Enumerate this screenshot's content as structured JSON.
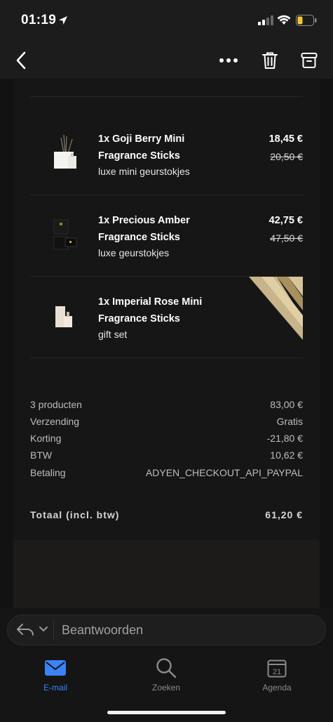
{
  "status": {
    "time": "01:19"
  },
  "products": [
    {
      "title_line1": "1x Goji Berry Mini",
      "title_line2": "Fragrance Sticks",
      "subtitle": "luxe mini geurstokjes",
      "price": "18,45 €",
      "old_price": "20,50 €"
    },
    {
      "title_line1": "1x Precious Amber",
      "title_line2": "Fragrance Sticks",
      "subtitle": "luxe geurstokjes",
      "price": "42,75 €",
      "old_price": "47,50 €"
    },
    {
      "title_line1": "1x Imperial Rose Mini",
      "title_line2": "Fragrance Sticks",
      "subtitle": "gift set",
      "price": "",
      "old_price": ""
    }
  ],
  "summary": [
    {
      "label": "3 producten",
      "value": "83,00 €"
    },
    {
      "label": "Verzending",
      "value": "Gratis"
    },
    {
      "label": "Korting",
      "value": "-21,80 €"
    },
    {
      "label": "BTW",
      "value": "10,62 €"
    },
    {
      "label": "Betaling",
      "value": "ADYEN_CHECKOUT_API_PAYPAL"
    }
  ],
  "total": {
    "label": "Totaal (incl. btw)",
    "value": "61,20 €"
  },
  "reply": {
    "placeholder": "Beantwoorden"
  },
  "tabs": [
    {
      "label": "E-mail",
      "icon": "mail-icon",
      "active": true
    },
    {
      "label": "Zoeken",
      "icon": "search-icon",
      "active": false
    },
    {
      "label": "Agenda",
      "icon": "calendar-icon",
      "active": false,
      "day": "21"
    }
  ],
  "colors": {
    "accent": "#3b82f6",
    "background": "#121212",
    "gift_gold": "#c8b48a"
  }
}
